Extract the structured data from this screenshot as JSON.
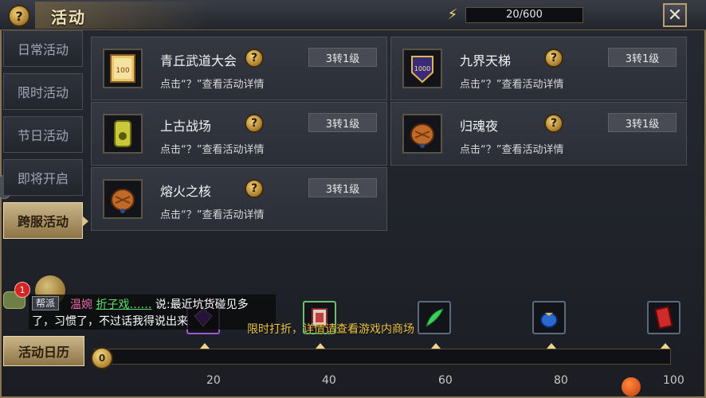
{
  "header": {
    "help_label": "?",
    "title": "活动",
    "energy_icon": "lightning-icon",
    "energy": "20/600",
    "close_label": "✕"
  },
  "tabs": [
    {
      "label": "日常活动",
      "active": false
    },
    {
      "label": "限时活动",
      "active": false
    },
    {
      "label": "节日活动",
      "active": false
    },
    {
      "label": "即将开启",
      "active": false
    },
    {
      "label": "跨服活动",
      "active": true
    }
  ],
  "activities": [
    {
      "name": "青丘武道大会",
      "level": "3转1级",
      "desc": "点击“？”查看活动详情",
      "icon": "trophy-banner-icon",
      "icon_text": "100"
    },
    {
      "name": "九界天梯",
      "level": "3转1级",
      "desc": "点击“？”查看活动详情",
      "icon": "ladder-shield-icon",
      "icon_text": "1000"
    },
    {
      "name": "上古战场",
      "level": "3转1级",
      "desc": "点击“？”查看活动详情",
      "icon": "jade-token-icon",
      "icon_text": ""
    },
    {
      "name": "归魂夜",
      "level": "3转1级",
      "desc": "点击“？”查看活动详情",
      "icon": "treasure-pouch-icon",
      "icon_text": ""
    },
    {
      "name": "熔火之核",
      "level": "3转1级",
      "desc": "点击“？”查看活动详情",
      "icon": "treasure-pouch-icon",
      "icon_text": ""
    }
  ],
  "calendar_button": "活动日历",
  "progress": {
    "current": 0,
    "max": 100,
    "coin_label": "0",
    "ticks": [
      "20",
      "40",
      "60",
      "80",
      "100"
    ],
    "rewards": [
      "purple-gem-icon",
      "card-pack-icon",
      "green-feather-icon",
      "blue-pouch-icon",
      "red-envelope-icon"
    ]
  },
  "chat": {
    "notify_count": "1",
    "tag": "帮派",
    "sender": "温婉",
    "to": "折子戏……",
    "message_prefix": "说:最近坑货碰见多",
    "message_line2": "了，习惯了，不过话我得说出来",
    "promo": "限时打折，详情请查看游戏内商场"
  },
  "colors": {
    "accent_gold": "#c9b588",
    "chat_pink": "#e86aa8",
    "chat_green": "#5ee06b",
    "promo_yellow": "#f0c84a"
  }
}
